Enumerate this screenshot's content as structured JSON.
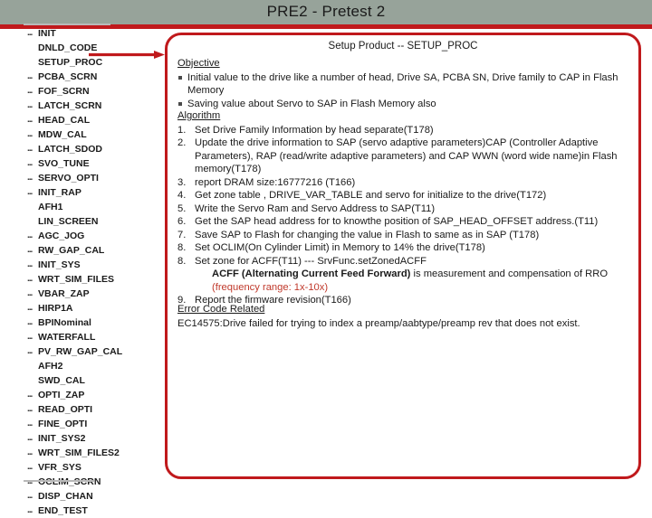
{
  "header": {
    "title": "PRE2 - Pretest 2",
    "band_color": "#97a39a",
    "rule_color": "#c0191c"
  },
  "sidebar": {
    "items": [
      {
        "label": "INIT",
        "dots": true
      },
      {
        "label": "DNLD_CODE",
        "dots": false
      },
      {
        "label": "SETUP_PROC",
        "dots": false
      },
      {
        "label": "PCBA_SCRN",
        "dots": true
      },
      {
        "label": "FOF_SCRN",
        "dots": true
      },
      {
        "label": "LATCH_SCRN",
        "dots": true
      },
      {
        "label": "HEAD_CAL",
        "dots": true
      },
      {
        "label": "MDW_CAL",
        "dots": true
      },
      {
        "label": "LATCH_SDOD",
        "dots": true
      },
      {
        "label": "SVO_TUNE",
        "dots": true
      },
      {
        "label": "SERVO_OPTI",
        "dots": true
      },
      {
        "label": "INIT_RAP",
        "dots": true
      },
      {
        "label": "AFH1",
        "dots": false
      },
      {
        "label": "LIN_SCREEN",
        "dots": false
      },
      {
        "label": "AGC_JOG",
        "dots": true
      },
      {
        "label": "RW_GAP_CAL",
        "dots": true
      },
      {
        "label": "INIT_SYS",
        "dots": true
      },
      {
        "label": "WRT_SIM_FILES",
        "dots": true
      },
      {
        "label": "VBAR_ZAP",
        "dots": true
      },
      {
        "label": "HIRP1A",
        "dots": true
      },
      {
        "label": "BPINominal",
        "dots": true
      },
      {
        "label": "WATERFALL",
        "dots": true
      },
      {
        "label": "PV_RW_GAP_CAL",
        "dots": true
      },
      {
        "label": "AFH2",
        "dots": false
      },
      {
        "label": "SWD_CAL",
        "dots": false
      },
      {
        "label": "OPTI_ZAP",
        "dots": true
      },
      {
        "label": "READ_OPTI",
        "dots": true
      },
      {
        "label": "FINE_OPTI",
        "dots": true
      },
      {
        "label": "INIT_SYS2",
        "dots": true
      },
      {
        "label": "WRT_SIM_FILES2",
        "dots": true
      },
      {
        "label": "VFR_SYS",
        "dots": true
      },
      {
        "label": "OCLIM_SCRN",
        "dots": true
      },
      {
        "label": "DISP_CHAN",
        "dots": true
      },
      {
        "label": "END_TEST",
        "dots": true
      }
    ],
    "highlighted_item": "SETUP_PROC",
    "arrow_color": "#c0191c"
  },
  "panel": {
    "border_color": "#c0191c",
    "heading": "Setup Product -- SETUP_PROC",
    "objective": {
      "title": "Objective",
      "bullets": [
        "Initial value to the drive like a number of head, Drive SA, PCBA SN, Drive family to CAP in Flash Memory",
        "Saving value about Servo to SAP in Flash Memory also"
      ]
    },
    "algorithm": {
      "title": "Algorithm",
      "steps": [
        {
          "num": "1.",
          "text": "Set Drive Family Information by head separate(T178)"
        },
        {
          "num": "2.",
          "text": "Update the drive information to SAP (servo adaptive parameters)CAP (Controller Adaptive Parameters), RAP (read/write adaptive parameters) and CAP WWN (word wide name)in Flash memory(T178)"
        },
        {
          "num": "3.",
          "text": "report DRAM size:16777216 (T166)"
        },
        {
          "num": "4.",
          "text": "Get zone table , DRIVE_VAR_TABLE and servo for initialize to the drive(T172)"
        },
        {
          "num": "5.",
          "text": "Write the Servo Ram and Servo Address to SAP(T11)"
        },
        {
          "num": "6.",
          "text": "Get the SAP head address for to knowthe position of SAP_HEAD_OFFSET address.(T11)"
        },
        {
          "num": "7.",
          "text": "Save SAP to Flash for changing the value in Flash to same as in SAP (T178)"
        },
        {
          "num": "8.",
          "text": "Set OCLIM(On Cylinder Limit) in Memory to 14% the drive(T178)"
        }
      ],
      "acff_step": {
        "num": "8.",
        "text": "Set zone for ACFF(T11) --- SrvFunc.setZonedACFF",
        "detail_bold": "ACFF (Alternating Current Feed Forward)",
        "detail_plain": " is measurement and compensation of RRO ",
        "detail_red": "(frequency range: 1x-10x)"
      },
      "last_step": {
        "num": "9.",
        "text": "Report the firmware revision(T166)"
      }
    },
    "error": {
      "title": "Error Code Related",
      "text": "EC14575:Drive failed for trying to index a preamp/aabtype/preamp rev that does not exist."
    }
  }
}
